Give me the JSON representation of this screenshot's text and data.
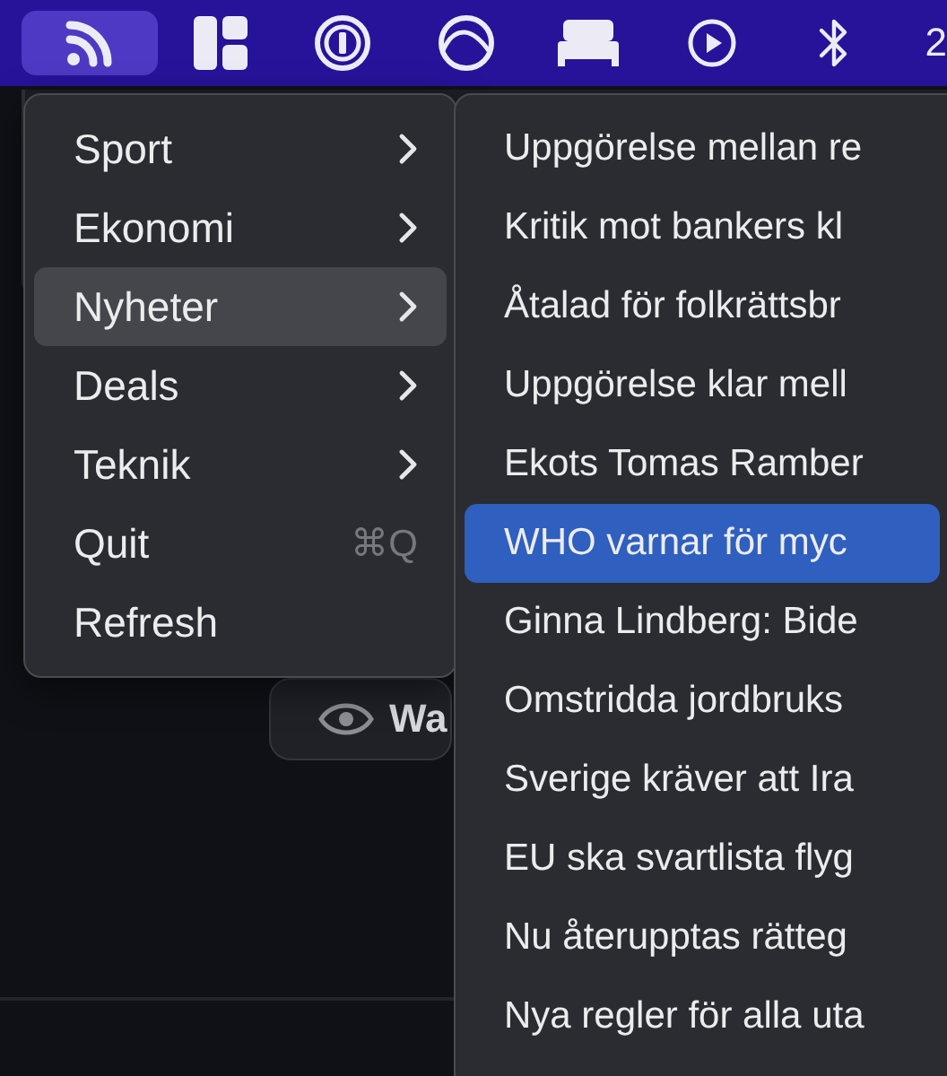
{
  "menu_bar": {
    "items": [
      {
        "kind": "rss",
        "selected": true
      },
      {
        "kind": "layout",
        "selected": false
      },
      {
        "kind": "password",
        "selected": false
      },
      {
        "kind": "arc",
        "selected": false
      },
      {
        "kind": "bed",
        "selected": false
      },
      {
        "kind": "play",
        "selected": false
      },
      {
        "kind": "bluetooth",
        "selected": false
      }
    ],
    "clock": "2"
  },
  "background": {
    "button": "Wa"
  },
  "menu": {
    "items": [
      {
        "label": "Sport",
        "submenu": true,
        "selected": false
      },
      {
        "label": "Ekonomi",
        "submenu": true,
        "selected": false
      },
      {
        "label": "Nyheter",
        "submenu": true,
        "selected": true
      },
      {
        "label": "Deals",
        "submenu": true,
        "selected": false
      },
      {
        "label": "Teknik",
        "submenu": true,
        "selected": false
      },
      {
        "label": "Quit",
        "submenu": false,
        "shortcut": "⌘Q",
        "selected": false
      },
      {
        "label": "Refresh",
        "submenu": false,
        "selected": false
      }
    ]
  },
  "submenu": {
    "items": [
      {
        "label": "Uppgörelse mellan re",
        "selected": false
      },
      {
        "label": "Kritik mot bankers kl",
        "selected": false
      },
      {
        "label": "Åtalad för folkrättsbr",
        "selected": false
      },
      {
        "label": "Uppgörelse klar mell",
        "selected": false
      },
      {
        "label": "Ekots Tomas Ramber",
        "selected": false
      },
      {
        "label": "WHO varnar för myc",
        "selected": true
      },
      {
        "label": "Ginna Lindberg: Bide",
        "selected": false
      },
      {
        "label": "Omstridda jordbruks",
        "selected": false
      },
      {
        "label": "Sverige kräver att Ira",
        "selected": false
      },
      {
        "label": "EU ska svartlista flyg",
        "selected": false
      },
      {
        "label": "Nu återupptas rätteg",
        "selected": false
      },
      {
        "label": "Nya regler för alla uta",
        "selected": false
      }
    ]
  }
}
